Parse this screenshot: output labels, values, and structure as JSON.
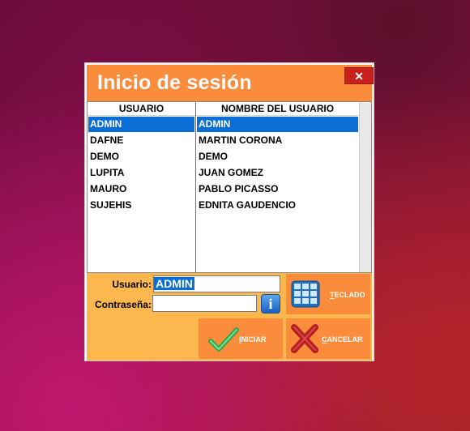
{
  "dialog": {
    "title": "Inicio de sesión",
    "close_label": "✕"
  },
  "list": {
    "headers": [
      "USUARIO",
      "NOMBRE DEL USUARIO"
    ],
    "rows": [
      {
        "user": "ADMIN",
        "name": "ADMIN",
        "selected": true
      },
      {
        "user": "DAFNE",
        "name": "MARTIN CORONA"
      },
      {
        "user": "DEMO",
        "name": "DEMO"
      },
      {
        "user": "LUPITA",
        "name": "JUAN GOMEZ"
      },
      {
        "user": "MAURO",
        "name": "PABLO PICASSO"
      },
      {
        "user": "SUJEHIS",
        "name": "EDNITA GAUDENCIO"
      }
    ]
  },
  "form": {
    "usuario_label": "Usuario:",
    "usuario_value": "ADMIN",
    "password_label": "Contraseña:",
    "password_value": "",
    "info_icon": "i"
  },
  "buttons": {
    "teclado_underlined": "T",
    "teclado_rest": "ECLADO",
    "iniciar_underlined": "I",
    "iniciar_rest": "NICIAR",
    "cancelar_underlined": "C",
    "cancelar_rest": "ANCELAR"
  },
  "colors": {
    "title_bar": "#fb8c3c",
    "panel": "#fcb84f",
    "selection": "#0b6ed6",
    "close": "#c8211b"
  }
}
